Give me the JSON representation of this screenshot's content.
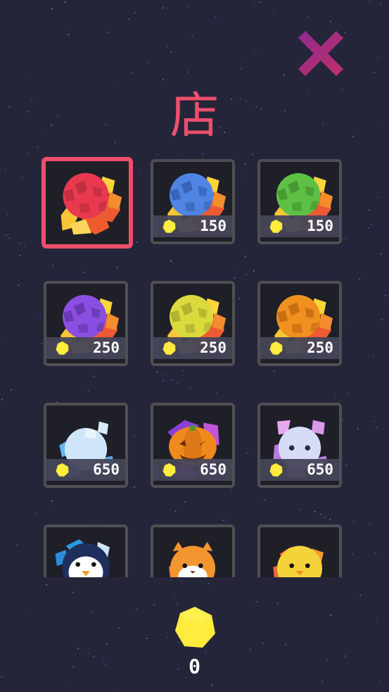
{
  "header": {
    "title": "店",
    "close_icon": "close-x-icon"
  },
  "colors": {
    "background": "#25253a",
    "title": "#ee4f6d",
    "selected_border": "#ef4d6c",
    "close_icon": "#a0256f",
    "coin": "#ffec3d"
  },
  "shop": {
    "items": [
      {
        "name": "red-ball",
        "price": "",
        "color": "#e8394f",
        "dark": "#b22b3c",
        "kind": "ball",
        "selected": true
      },
      {
        "name": "blue-ball",
        "price": "150",
        "color": "#4f84e2",
        "dark": "#2f59a8",
        "kind": "ball"
      },
      {
        "name": "green-ball",
        "price": "150",
        "color": "#5ec045",
        "dark": "#3d8a2a",
        "kind": "ball"
      },
      {
        "name": "purple-ball",
        "price": "250",
        "color": "#8a4fe0",
        "dark": "#5a2fa2",
        "kind": "ball"
      },
      {
        "name": "yellow-ball",
        "price": "250",
        "color": "#dada3c",
        "dark": "#a3a32a",
        "kind": "ball"
      },
      {
        "name": "orange-ball",
        "price": "250",
        "color": "#f0901e",
        "dark": "#b45f10",
        "kind": "ball"
      },
      {
        "name": "ice-ball",
        "price": "650",
        "color": "#cfe6fa",
        "dark": "#a5c9ee",
        "kind": "ice"
      },
      {
        "name": "pumpkin-ball",
        "price": "650",
        "color": "#f18a1c",
        "dark": "#b85a0c",
        "kind": "pumpkin"
      },
      {
        "name": "ghost-ball",
        "price": "650",
        "color": "#d6dcf6",
        "dark": "#a8b1e6",
        "kind": "ghost"
      },
      {
        "name": "penguin-ball",
        "price": "",
        "color": "#1d2f5c",
        "dark": "#0f1b3a",
        "kind": "penguin"
      },
      {
        "name": "cat-ball",
        "price": "",
        "color": "#f3962f",
        "dark": "#c46b14",
        "kind": "cat"
      },
      {
        "name": "chick-ball",
        "price": "",
        "color": "#f4d33a",
        "dark": "#c9a820",
        "kind": "chick"
      }
    ]
  },
  "wallet": {
    "coin_icon": "coin-icon",
    "balance": "0"
  }
}
